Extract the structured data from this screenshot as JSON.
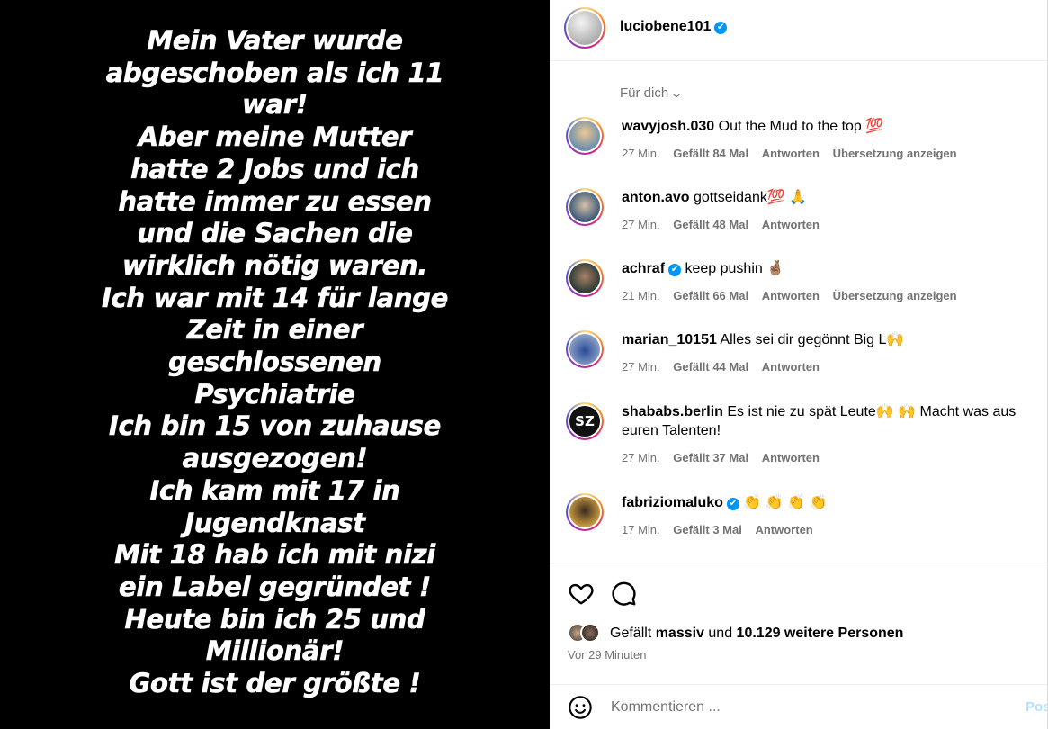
{
  "story": {
    "lines": [
      "Mein Vater wurde",
      "abgeschoben als ich 11",
      "war!",
      "Aber meine  Mutter",
      "hatte 2 Jobs und ich",
      "hatte immer zu essen",
      "und die Sachen die",
      "wirklich nötig waren.",
      "Ich war mit 14 für lange",
      "Zeit in einer",
      "geschlossenen",
      "Psychiatrie",
      "Ich bin 15 von zuhause",
      "ausgezogen!",
      "Ich kam mit 17 in",
      "Jugendknast",
      "Mit 18 hab ich mit nizi",
      "ein Label gegründet !",
      "Heute bin ich 25 und",
      "Millionär!",
      "Gott ist der größte !"
    ]
  },
  "header": {
    "username": "luciobene101",
    "verified_icon": "✔"
  },
  "sort": {
    "label": "Für dich",
    "chevron_icon": "⌄"
  },
  "comments": [
    {
      "user": "wavyjosh.030",
      "text": " Out the Mud to the top 💯",
      "time": "27 Min.",
      "likes": "Gefällt 84 Mal",
      "reply": "Antworten",
      "translate": "Übersetzung anzeigen"
    },
    {
      "user": "anton.avo",
      "text": " gottseidank💯 🙏",
      "time": "27 Min.",
      "likes": "Gefällt 48 Mal",
      "reply": "Antworten"
    },
    {
      "user": "achraf",
      "text": " keep pushin 🤞🏽",
      "time": "21 Min.",
      "likes": "Gefällt 66 Mal",
      "reply": "Antworten",
      "translate": "Übersetzung anzeigen"
    },
    {
      "user": "marian_10151",
      "text": " Alles sei dir gegönnt Big L🙌",
      "time": "27 Min.",
      "likes": "Gefällt 44 Mal",
      "reply": "Antworten"
    },
    {
      "user": "shababs.berlin",
      "text": " Es ist nie zu spät Leute🙌 🙌  Macht was aus euren Talenten!",
      "time": "27 Min.",
      "likes": "Gefällt 37 Mal",
      "reply": "Antworten",
      "avatar_text": "SZ"
    },
    {
      "user": "fabriziomaluko",
      "text": " 👏 👏 👏 👏",
      "time": "17 Min.",
      "likes": "Gefällt 3 Mal",
      "reply": "Antworten"
    }
  ],
  "likes": {
    "prefix": "Gefällt ",
    "user": "massiv",
    "middle": " und ",
    "count": "10.129 weitere Personen",
    "time_ago": "Vor 29 Minuten"
  },
  "comment_box": {
    "placeholder": "Kommentieren ...",
    "post_label": "Posten"
  },
  "colors": {
    "accent": "#0095f6",
    "muted": "#737373"
  }
}
